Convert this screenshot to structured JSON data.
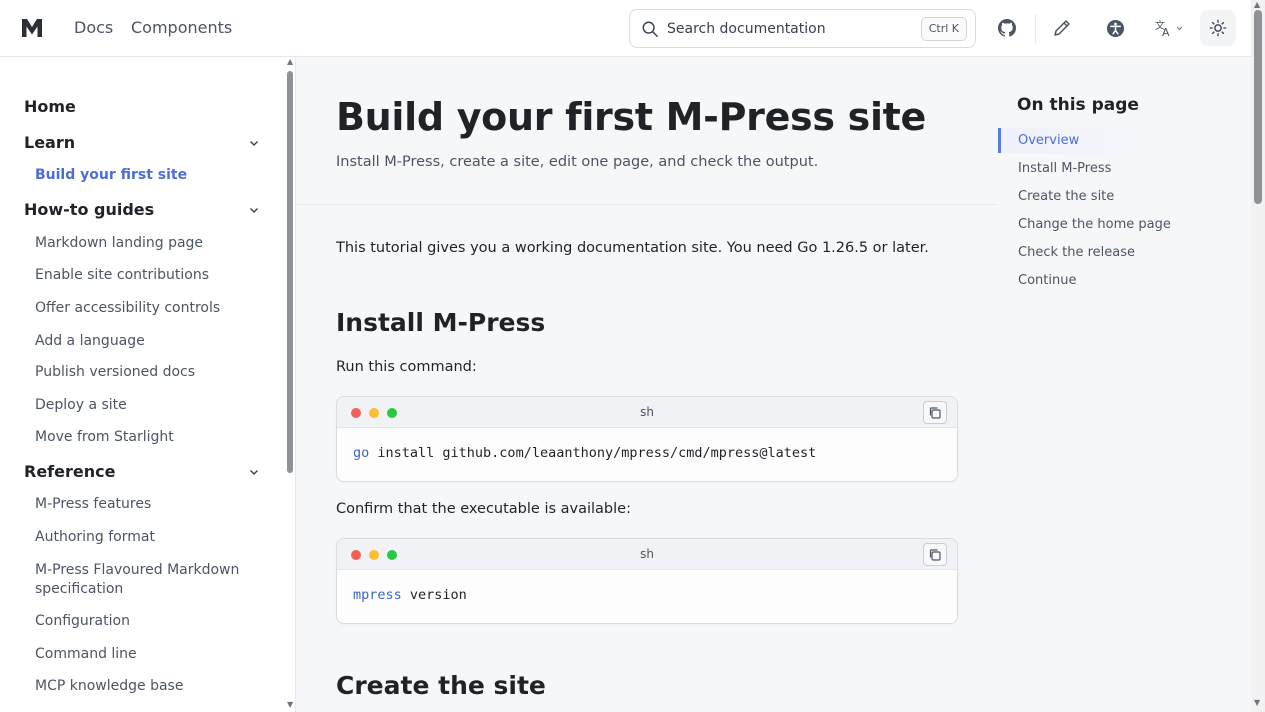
{
  "header": {
    "nav": [
      "Docs",
      "Components"
    ],
    "search_placeholder": "Search documentation",
    "search_shortcut": "Ctrl K"
  },
  "sidebar": {
    "home": "Home",
    "groups": [
      {
        "label": "Learn",
        "items": [
          "Build your first site"
        ]
      },
      {
        "label": "How-to guides",
        "items": [
          "Markdown landing page",
          "Enable site contributions",
          "Offer accessibility controls",
          "Add a language",
          "Publish versioned docs",
          "Deploy a site",
          "Move from Starlight"
        ]
      },
      {
        "label": "Reference",
        "items": [
          "M-Press features",
          "Authoring format",
          "M-Press Flavoured Markdown specification",
          "Configuration",
          "Command line",
          "MCP knowledge base"
        ]
      }
    ],
    "active_item": "Build your first site"
  },
  "main": {
    "title": "Build your first M-Press site",
    "subtitle": "Install M-Press, create a site, edit one page, and check the output.",
    "intro": "This tutorial gives you a working documentation site. You need Go 1.26.5 or later.",
    "sections": [
      {
        "heading": "Install M-Press"
      },
      {
        "heading": "Create the site"
      }
    ],
    "para_run": "Run this command:",
    "para_confirm": "Confirm that the executable is available:",
    "code_blocks": [
      {
        "lang": "sh",
        "keyword": "go",
        "rest": " install github.com/leaanthony/mpress/cmd/mpress@latest"
      },
      {
        "lang": "sh",
        "keyword": "mpress",
        "rest": " version"
      }
    ]
  },
  "toc": {
    "title": "On this page",
    "items": [
      "Overview",
      "Install M-Press",
      "Create the site",
      "Change the home page",
      "Check the release",
      "Continue"
    ],
    "active": "Overview"
  },
  "colors": {
    "accent": "#4a6fd8",
    "code_keyword": "#3a66c4"
  },
  "icons": [
    "logo-m-icon",
    "search-icon",
    "github-icon",
    "pencil-icon",
    "accessibility-icon",
    "translate-icon",
    "sun-icon",
    "chevron-down-icon",
    "copy-icon"
  ]
}
